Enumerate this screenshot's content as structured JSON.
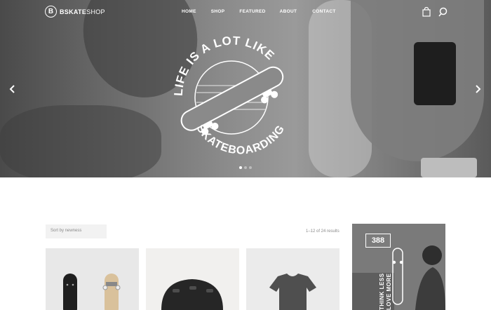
{
  "brand": {
    "mark": "B",
    "name_bold": "BSKATE",
    "name_light": "SHOP"
  },
  "nav": {
    "items": [
      "HOME",
      "SHOP",
      "FEATURED",
      "ABOUT",
      "CONTACT"
    ]
  },
  "hero": {
    "emblem_top": "LIFE IS A LOT LIKE",
    "emblem_bottom": "SKATEBOARDING",
    "slides": 3,
    "active_slide": 1
  },
  "shop": {
    "sort_label": "Sort by newness",
    "results": "1–12 of 24 results"
  },
  "promo": {
    "sign": "388",
    "line1": "THINK LESS",
    "line2": "LOVE MORE"
  }
}
